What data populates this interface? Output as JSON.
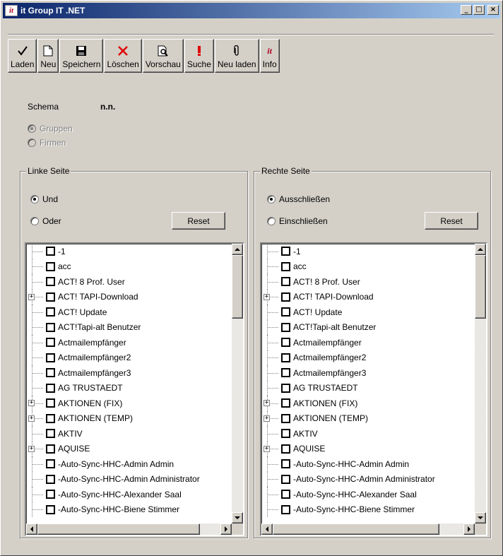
{
  "window": {
    "title": "it Group IT .NET",
    "app_icon_text": "it",
    "minimize_glyph": "_",
    "maximize_glyph": "□",
    "close_glyph": "×"
  },
  "toolbar": {
    "buttons": [
      {
        "label": "Laden",
        "icon": "checkmark-icon"
      },
      {
        "label": "Neu",
        "icon": "new-document-icon"
      },
      {
        "label": "Speichern",
        "icon": "floppy-disk-icon"
      },
      {
        "label": "Löschen",
        "icon": "delete-x-icon"
      },
      {
        "label": "Vorschau",
        "icon": "print-preview-icon"
      },
      {
        "label": "Suche",
        "icon": "exclamation-icon"
      },
      {
        "label": "Neu laden",
        "icon": "paperclip-icon"
      },
      {
        "label": "Info",
        "icon": "info-it-icon"
      }
    ],
    "info_icon_text": "it"
  },
  "schema": {
    "label": "Schema",
    "value": "n.n.",
    "options": [
      {
        "label": "Gruppen",
        "checked": true,
        "enabled": false
      },
      {
        "label": "Firmen",
        "checked": false,
        "enabled": false
      }
    ]
  },
  "left_panel": {
    "title": "Linke Seite",
    "options": [
      {
        "label": "Und",
        "checked": true
      },
      {
        "label": "Oder",
        "checked": false
      }
    ],
    "reset_label": "Reset"
  },
  "right_panel": {
    "title": "Rechte Seite",
    "options": [
      {
        "label": "Ausschließen",
        "checked": true
      },
      {
        "label": "Einschließen",
        "checked": false
      }
    ],
    "reset_label": "Reset"
  },
  "tree_items": [
    {
      "label": "-1",
      "expandable": false
    },
    {
      "label": "acc",
      "expandable": false
    },
    {
      "label": "ACT! 8 Prof. User",
      "expandable": false
    },
    {
      "label": "ACT! TAPI-Download",
      "expandable": true
    },
    {
      "label": "ACT! Update",
      "expandable": false
    },
    {
      "label": "ACT!Tapi-alt Benutzer",
      "expandable": false
    },
    {
      "label": "Actmailempfänger",
      "expandable": false
    },
    {
      "label": "Actmailempfänger2",
      "expandable": false
    },
    {
      "label": "Actmailempfänger3",
      "expandable": false
    },
    {
      "label": "AG TRUSTAEDT",
      "expandable": false
    },
    {
      "label": "AKTIONEN (FIX)",
      "expandable": true
    },
    {
      "label": "AKTIONEN (TEMP)",
      "expandable": true
    },
    {
      "label": "AKTIV",
      "expandable": false
    },
    {
      "label": "AQUISE",
      "expandable": true
    },
    {
      "label": "-Auto-Sync-HHC-Admin Admin",
      "expandable": false
    },
    {
      "label": "-Auto-Sync-HHC-Admin Administrator",
      "expandable": false
    },
    {
      "label": "-Auto-Sync-HHC-Alexander Saal",
      "expandable": false
    },
    {
      "label": "-Auto-Sync-HHC-Biene Stimmer",
      "expandable": false
    }
  ],
  "expander_glyph": "+"
}
